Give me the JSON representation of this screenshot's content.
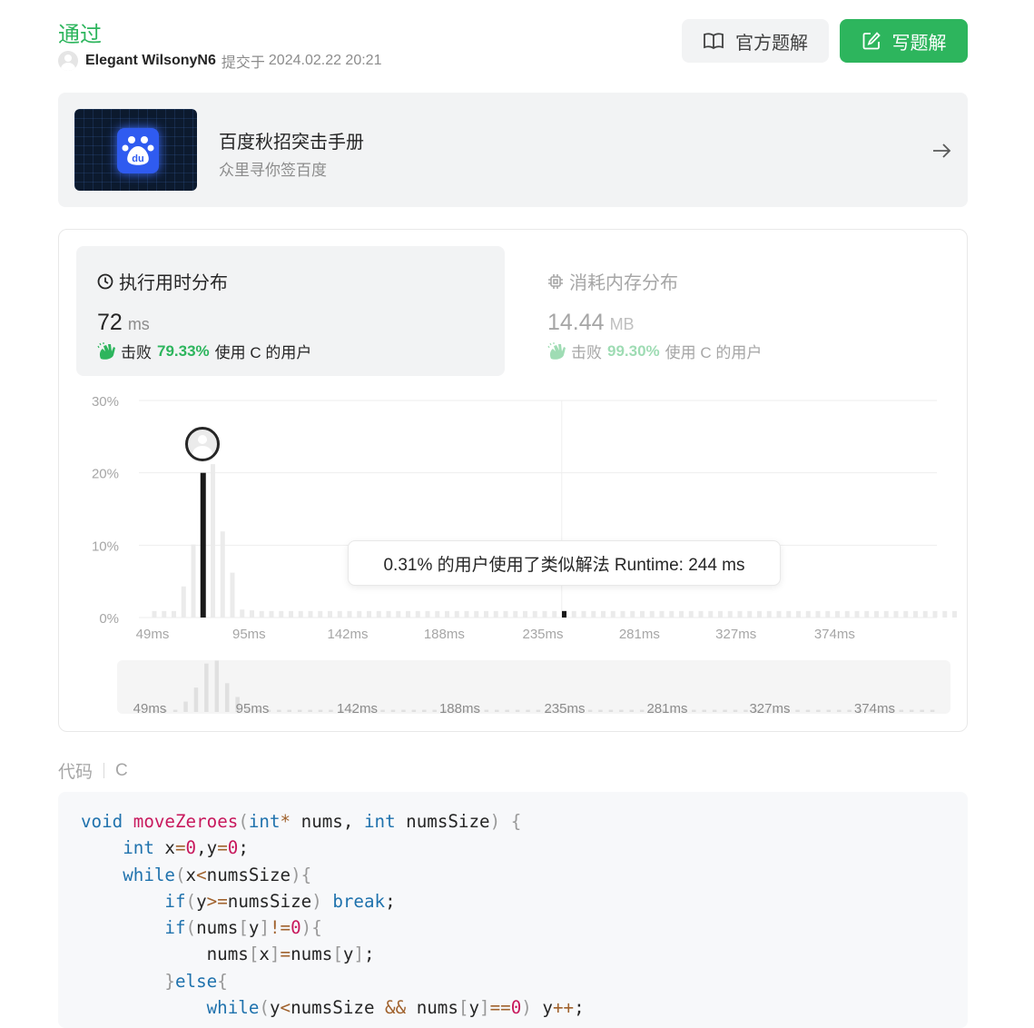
{
  "submission": {
    "status": "通过",
    "user_name": "Elegant WilsonyN6",
    "submitted_label": "提交于",
    "submitted_time": "2024.02.22 20:21"
  },
  "buttons": {
    "official_solution": "官方题解",
    "write_solution": "写题解"
  },
  "promo": {
    "title": "百度秋招突击手册",
    "subtitle": "众里寻你签百度",
    "logo_text": "du"
  },
  "runtime_card": {
    "title": "执行用时分布",
    "value": "72",
    "unit": "ms",
    "beat_prefix": "击败",
    "beat_pct": "79.33%",
    "beat_suffix": "使用 C 的用户"
  },
  "memory_card": {
    "title": "消耗内存分布",
    "value": "14.44",
    "unit": "MB",
    "beat_prefix": "击败",
    "beat_pct": "99.30%",
    "beat_suffix": "使用 C 的用户"
  },
  "tooltip": "0.31% 的用户使用了类似解法 Runtime: 244 ms",
  "chart_data": {
    "type": "bar",
    "y_ticks": [
      "30%",
      "20%",
      "10%",
      "0%"
    ],
    "ylim": [
      0,
      30
    ],
    "x_tick_labels": [
      "49ms",
      "95ms",
      "142ms",
      "188ms",
      "235ms",
      "281ms",
      "327ms",
      "374ms"
    ],
    "x_ticks": [
      49,
      95,
      142,
      188,
      235,
      281,
      327,
      374
    ],
    "bin_width_ms": 4.65,
    "x_start_ms": 49,
    "values": [
      0.9,
      0.9,
      0.9,
      4.3,
      10.1,
      20.0,
      21.2,
      11.9,
      6.2,
      1.1,
      1.0,
      0.9,
      0.9,
      0.9,
      0.9,
      0.9,
      0.9,
      0.9,
      0.9,
      0.9,
      0.9,
      0.9,
      0.9,
      0.9,
      0.9,
      0.9,
      0.9,
      0.9,
      0.9,
      0.9,
      0.9,
      0.9,
      0.9,
      0.9,
      0.9,
      0.9,
      0.9,
      0.9,
      0.9,
      0.9,
      0.9,
      0.9,
      0.9,
      0.9,
      0.9,
      0.9,
      0.9,
      0.9,
      0.9,
      0.9,
      0.9,
      0.9,
      0.9,
      0.9,
      0.9,
      0.9,
      0.9,
      0.9,
      0.9,
      0.9,
      0.9,
      0.9,
      0.9,
      0.9,
      0.9,
      0.9,
      0.9,
      0.9,
      0.9,
      0.9,
      0.9,
      0.9,
      0.9,
      0.9,
      0.9,
      0.9,
      0.9,
      0.9,
      0.9,
      0.9,
      0.9,
      0.9,
      0.9
    ],
    "highlight_user_ms": 72,
    "hover_ms": 244,
    "grid": true
  },
  "code": {
    "label": "代码",
    "language": "C"
  },
  "colors": {
    "accent": "#2db55d",
    "highlight_bar": "#1a1a1a",
    "bar": "#ebebeb"
  }
}
